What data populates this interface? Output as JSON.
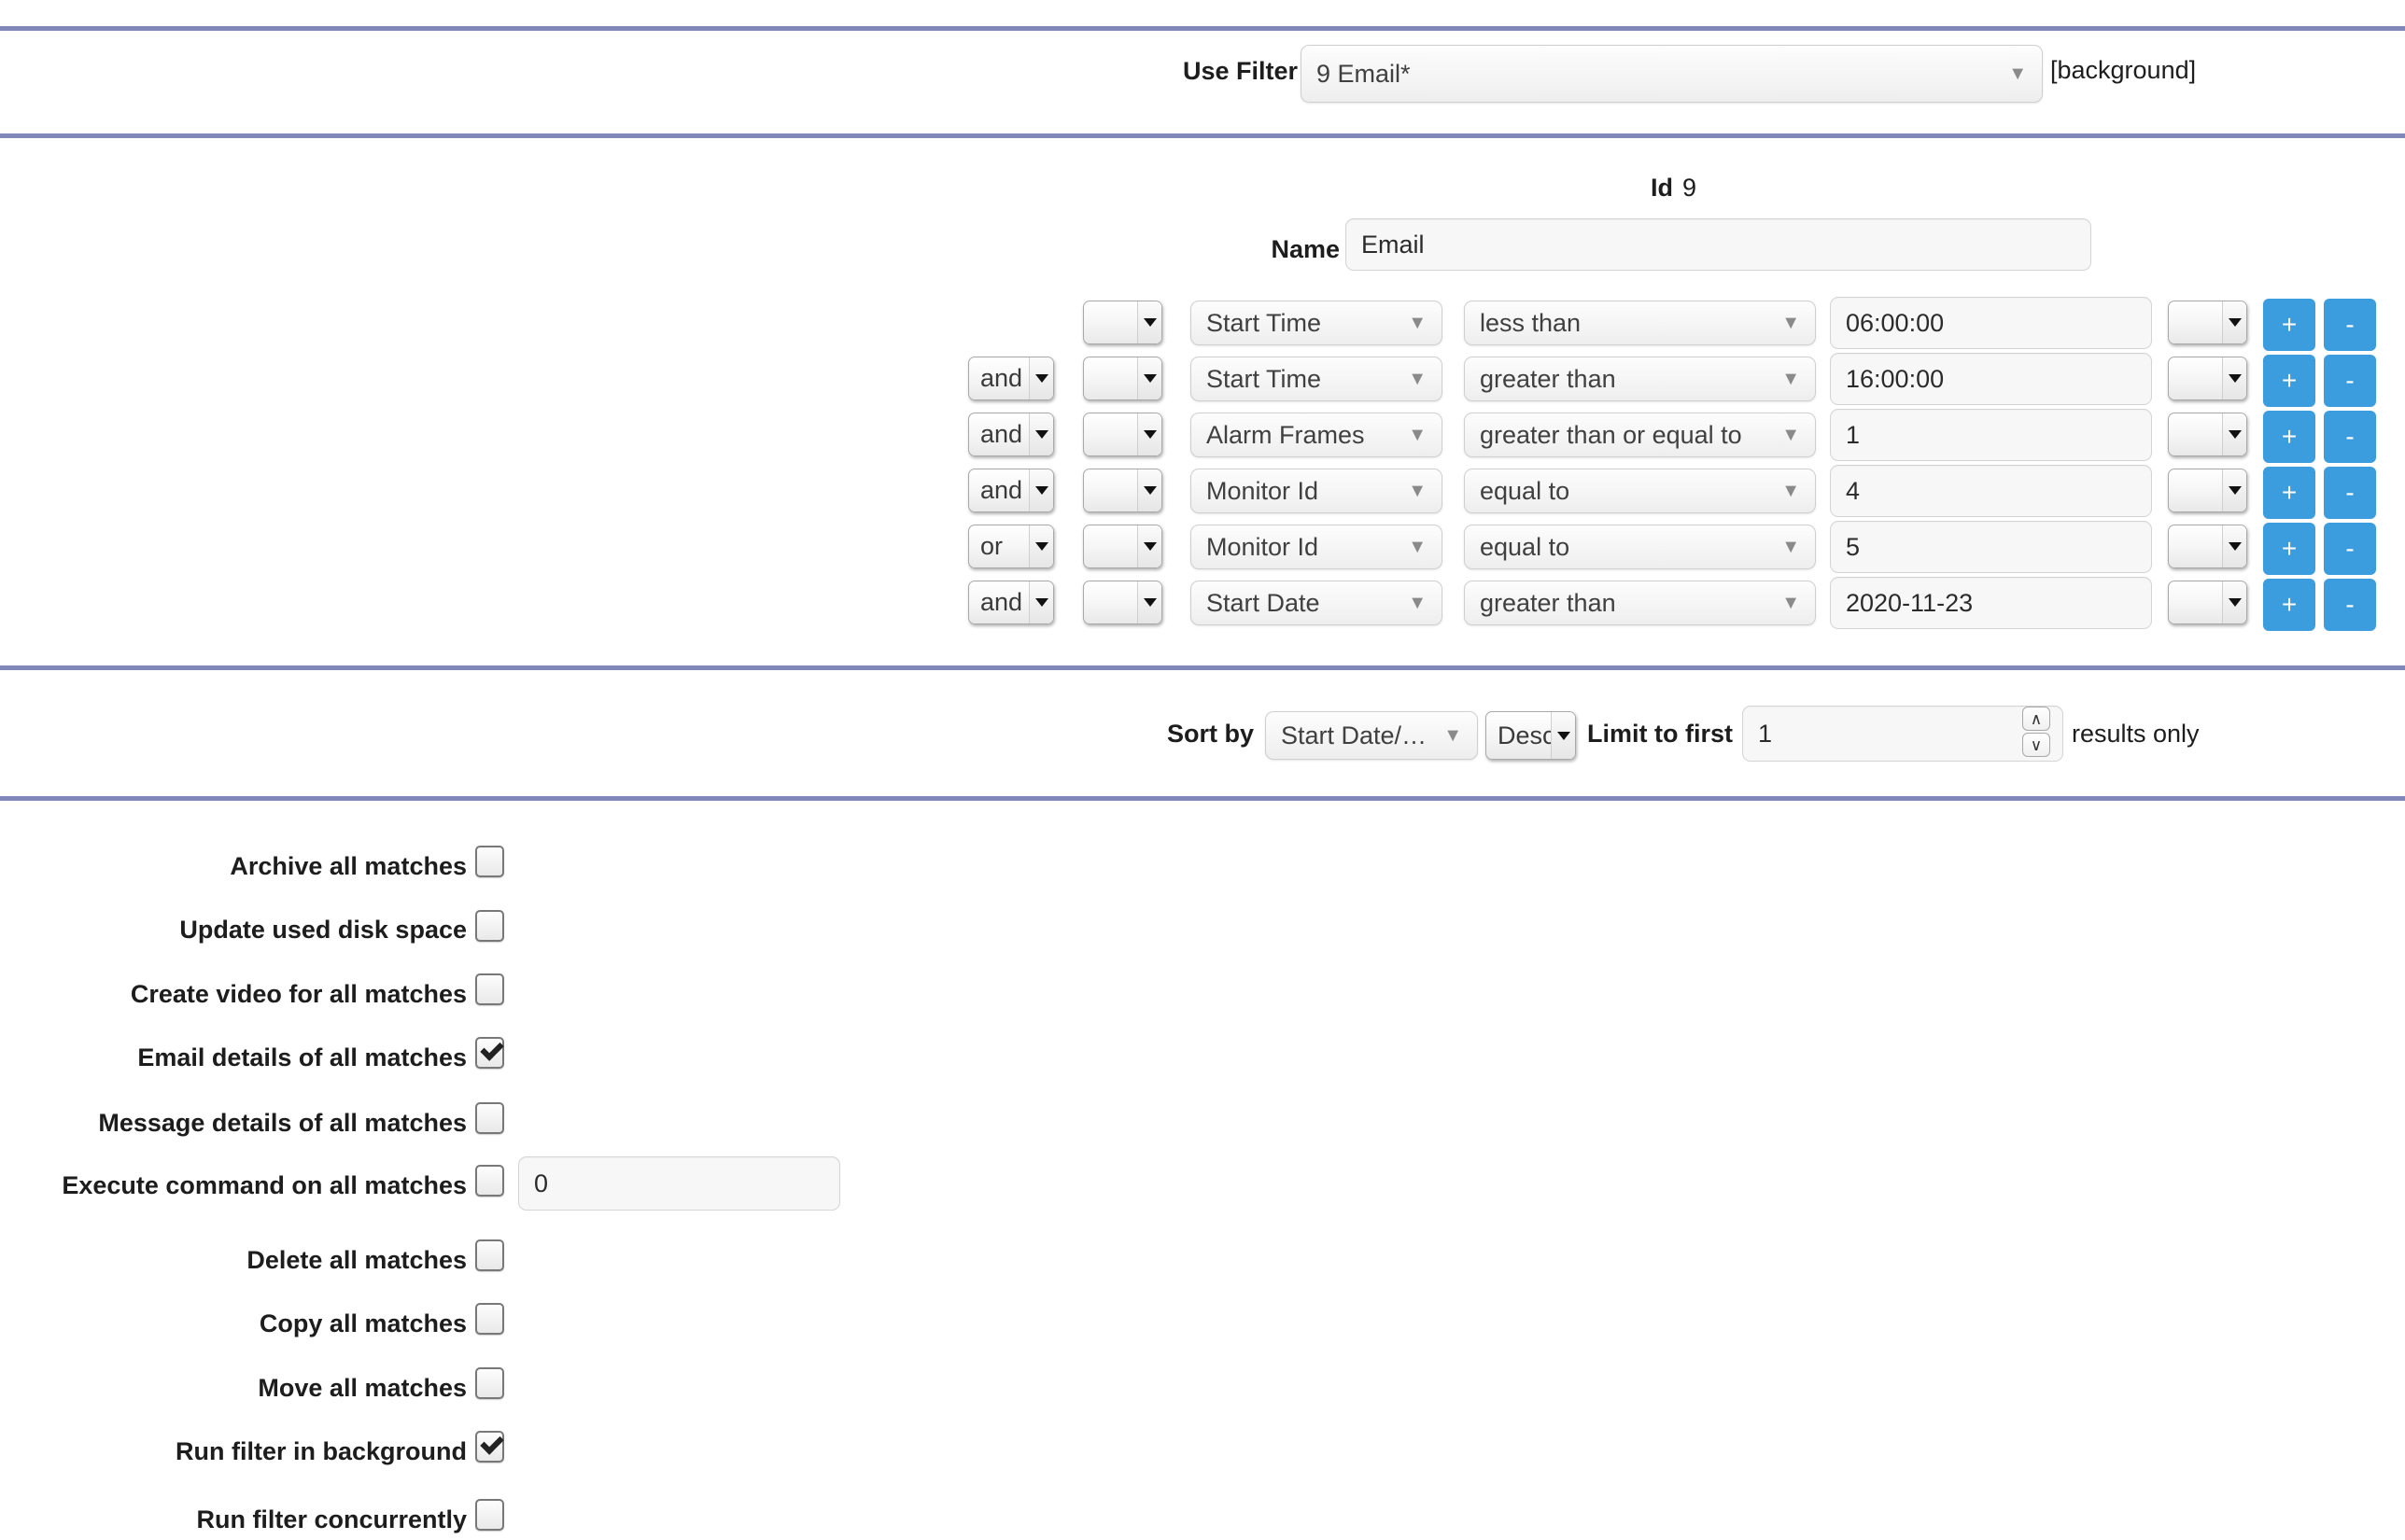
{
  "dividers_y": [
    28,
    143,
    713,
    853
  ],
  "colors": {
    "divider": "#8187b8",
    "button_blue": "#3b9ddd"
  },
  "top_bar": {
    "use_filter_label": "Use Filter",
    "selected_filter": "9 Email*",
    "background_note": "[background]"
  },
  "filter": {
    "id_label": "Id",
    "id_value": "9",
    "name_label": "Name",
    "name_value": "Email",
    "name_placeholder": "",
    "conjunction_placeholder": "",
    "bracket_placeholder": "",
    "add_label": "+",
    "remove_label": "-",
    "rows": [
      {
        "conjunction": "",
        "open_bracket": "",
        "attribute": "Start Time",
        "operator": "less than",
        "value": "06:00:00",
        "close_bracket": ""
      },
      {
        "conjunction": "and",
        "open_bracket": "",
        "attribute": "Start Time",
        "operator": "greater than",
        "value": "16:00:00",
        "close_bracket": ""
      },
      {
        "conjunction": "and",
        "open_bracket": "",
        "attribute": "Alarm Frames",
        "operator": "greater than or equal to",
        "value": "1",
        "close_bracket": ""
      },
      {
        "conjunction": "and",
        "open_bracket": "",
        "attribute": "Monitor Id",
        "operator": "equal to",
        "value": "4",
        "close_bracket": ""
      },
      {
        "conjunction": "or",
        "open_bracket": "",
        "attribute": "Monitor Id",
        "operator": "equal to",
        "value": "5",
        "close_bracket": ""
      },
      {
        "conjunction": "and",
        "open_bracket": "",
        "attribute": "Start Date",
        "operator": "greater than",
        "value": "2020-11-23",
        "close_bracket": ""
      }
    ]
  },
  "sort": {
    "sort_by_label": "Sort by",
    "sort_field": "Start Date/…",
    "sort_direction": "Desc",
    "limit_label": "Limit to first",
    "limit_value": "1",
    "results_suffix": "results only"
  },
  "actions": [
    {
      "label": "Archive all matches",
      "checked": false,
      "has_input": false,
      "input_value": ""
    },
    {
      "label": "Update used disk space",
      "checked": false,
      "has_input": false,
      "input_value": ""
    },
    {
      "label": "Create video for all matches",
      "checked": false,
      "has_input": false,
      "input_value": ""
    },
    {
      "label": "Email details of all matches",
      "checked": true,
      "has_input": false,
      "input_value": ""
    },
    {
      "label": "Message details of all matches",
      "checked": false,
      "has_input": false,
      "input_value": ""
    },
    {
      "label": "Execute command on all matches",
      "checked": false,
      "has_input": true,
      "input_value": "0"
    },
    {
      "label": "Delete all matches",
      "checked": false,
      "has_input": false,
      "input_value": ""
    },
    {
      "label": "Copy all matches",
      "checked": false,
      "has_input": false,
      "input_value": ""
    },
    {
      "label": "Move all matches",
      "checked": false,
      "has_input": false,
      "input_value": ""
    },
    {
      "label": "Run filter in background",
      "checked": true,
      "has_input": false,
      "input_value": ""
    },
    {
      "label": "Run filter concurrently",
      "checked": false,
      "has_input": false,
      "input_value": ""
    }
  ],
  "icons": {
    "caret_down": "▼",
    "spin_up": "∧",
    "spin_down": "∨"
  }
}
